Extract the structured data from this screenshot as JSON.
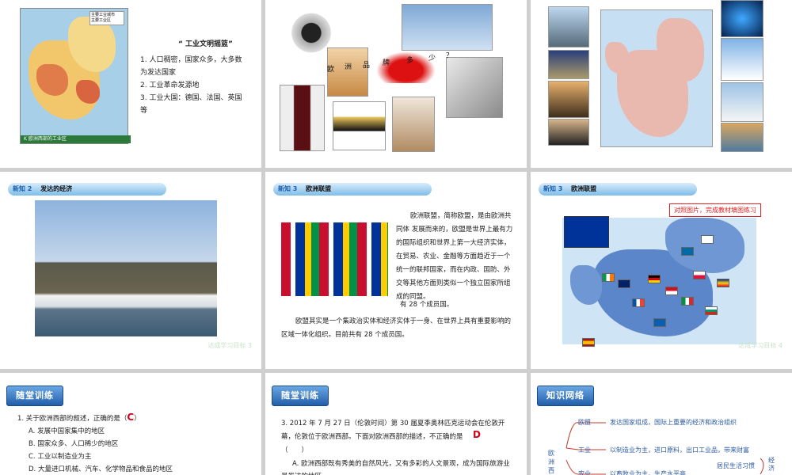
{
  "slide1": {
    "map_legend": [
      "主要工业城市",
      "主要工业区"
    ],
    "map_caption": "K 欧洲西部的工业区",
    "heading": "“ 工业文明摇篮”",
    "points": [
      "1. 人口稠密，国家众多，大多数为发达国家",
      "2. 工业革命发源地",
      "3. 工业大国：德国、法国、英国等"
    ]
  },
  "slide2": {
    "question_chars": [
      "欧",
      "洲",
      "品",
      "牌",
      "多",
      "少",
      "？"
    ]
  },
  "slide4": {
    "tag": "新知 2",
    "title": "发达的经济",
    "watermark": "达成学习目标 3"
  },
  "slide5": {
    "tag": "新知 3",
    "title": "欧洲联盟",
    "para1": "欧洲联盟，简称欧盟，是由欧洲共同体 发展而来的，欧盟是世界上最有力的国际组织和世界上第一大经济实体，在贸易、农业、金融等方面趋近于一个统一的联邦国家，而在内政、国防、外交等其他方面则类似一个独立国家所组成的同盟。",
    "para2": "有 28 个成员国。",
    "para3": "欧盟其实是一个集政治实体和经济实体于一身、在世界上具有重要影响的区域一体化组织。目前共有 28 个成员国。"
  },
  "slide6": {
    "tag": "新知 3",
    "title": "欧洲联盟",
    "note": "对照图片，完成教材填图练习",
    "watermark": "达成学习目标 4"
  },
  "slide7": {
    "banner": "随堂训练",
    "question": "1. 关于欧洲西部的叙述，正确的是（",
    "answer": "C",
    "question_end": "）",
    "options": [
      "A. 发展中国家集中的地区",
      "B. 国家众多、人口稀少的地区",
      "C. 工业以制造业为主",
      "D. 大量进口机械、汽车、化学物品和食品的地区"
    ]
  },
  "slide8": {
    "banner": "随堂训练",
    "question": "3. 2012 年 7 月 27 日（伦敦时间）第 30 届夏季奥林匹克运动会在伦敦开幕，伦敦位于欧洲西部。下面对欧洲西部的描述，不正确的是",
    "blank": "（　　）",
    "answer": "D",
    "option_a": "A. 欧洲西部既有秀美的自然风光，又有多彩的人文景观，成为国际旅游业最发达的地区"
  },
  "slide9": {
    "banner": "知识网络",
    "root": "欧洲西部",
    "branches": [
      {
        "label": "欧盟",
        "text": "发达国家组成，国际上重要的经济和政治组织"
      },
      {
        "label": "工业",
        "text": "以制造业为主，进口原料，出口工业品，带来财富"
      },
      {
        "label": "农业",
        "text": "以畜牧业为主，生产水平高"
      }
    ],
    "side_text": "居民生活习惯",
    "side_label": "经济"
  },
  "colors": {
    "bar": "#7fbde9",
    "banner": "#215ea9",
    "answer": "#d0021b",
    "note": "#e02020"
  }
}
